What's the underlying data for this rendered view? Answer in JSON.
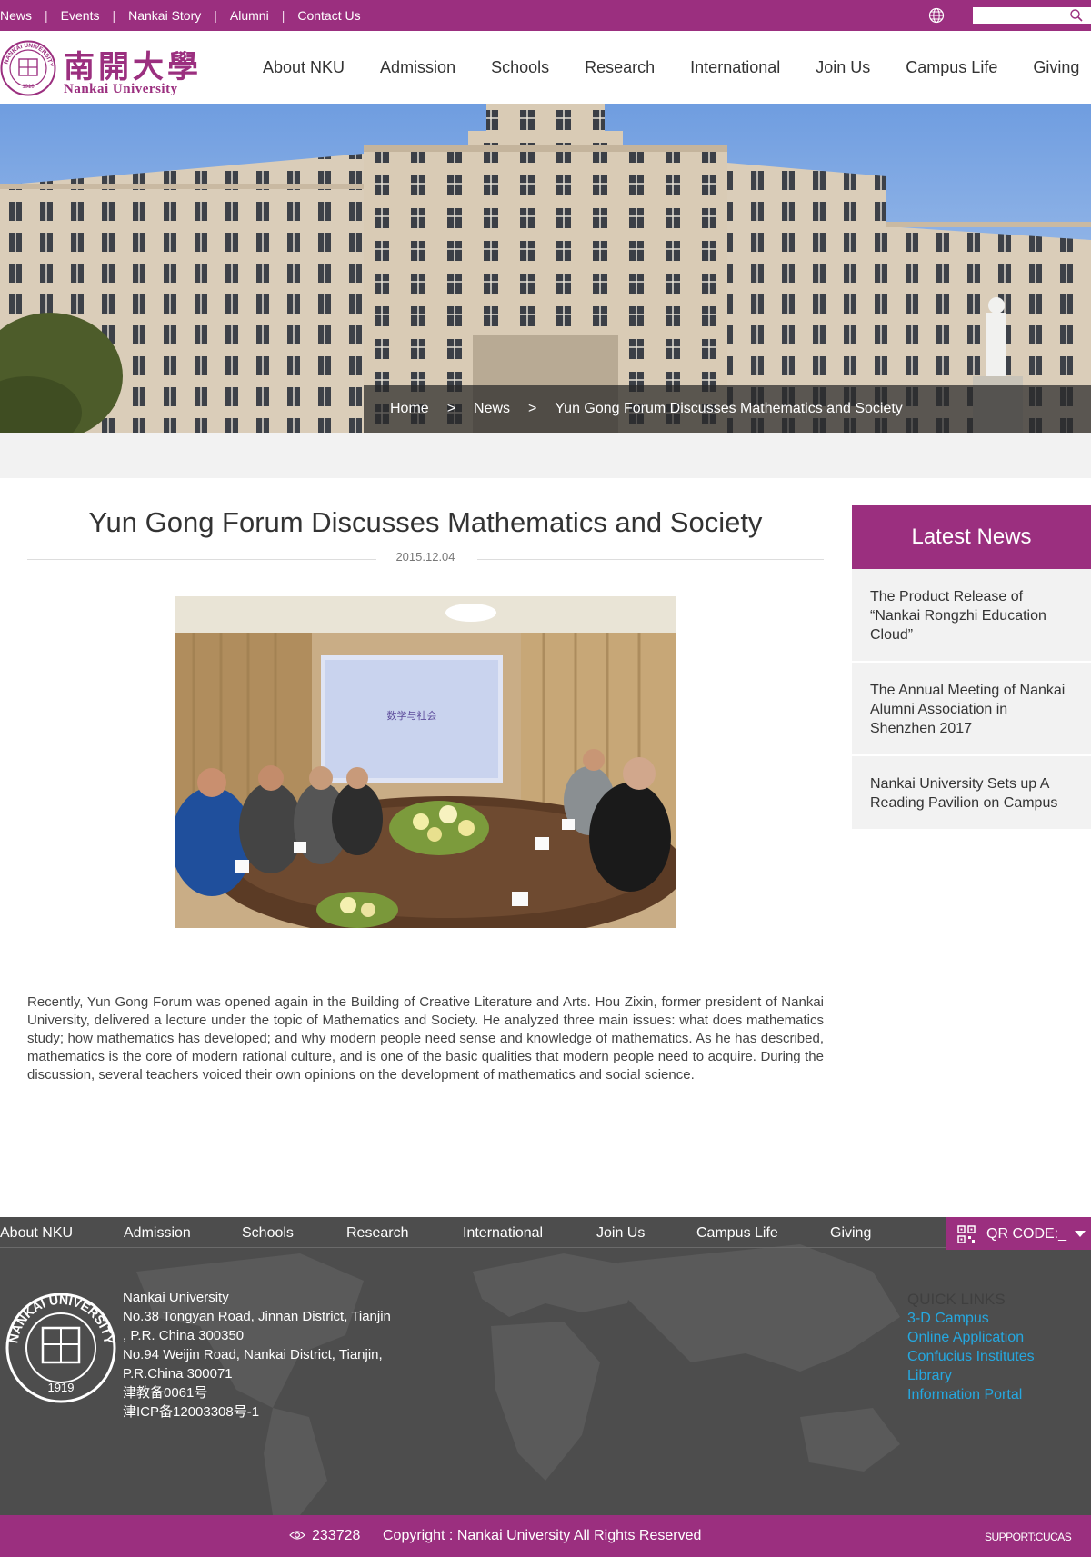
{
  "topbar": {
    "links": [
      "News",
      "Events",
      "Nankai Story",
      "Alumni",
      "Contact Us"
    ],
    "separator": "|",
    "search_placeholder": ""
  },
  "header": {
    "logo_cn": "南開大學",
    "logo_en": "Nankai University",
    "logo_seal_text": "NANKAI UNIVERSITY",
    "logo_seal_year": "1919",
    "nav": [
      "About NKU",
      "Admission",
      "Schools",
      "Research",
      "International",
      "Join Us",
      "Campus Life",
      "Giving"
    ]
  },
  "breadcrumb": {
    "home": "Home",
    "section": "News",
    "current": "Yun Gong Forum Discusses Mathematics and Society",
    "separator": ">"
  },
  "article": {
    "title": "Yun Gong Forum Discusses Mathematics and Society",
    "date": "2015.12.04",
    "photo_screen_title": "数学与社会",
    "body": "Recently, Yun Gong Forum was opened again in the Building of Creative Literature and Arts. Hou Zixin, former president of Nankai University, delivered a lecture under the topic of Mathematics and Society. He analyzed three main issues: what does mathematics study; how mathematics has developed; and why modern people need sense and knowledge of mathematics. As he has described, mathematics is the core of modern rational culture, and is one of the basic qualities that modern people need to acquire. During the discussion, several teachers voiced their own opinions on the development of mathematics and social science."
  },
  "sidebar": {
    "heading": "Latest News",
    "items": [
      "The Product Release of “Nankai Rongzhi Education Cloud”",
      "The Annual Meeting of Nankai Alumni Association in Shenzhen 2017",
      "Nankai University Sets up A Reading Pavilion on Campus"
    ]
  },
  "footer": {
    "nav": [
      "About NKU",
      "Admission",
      "Schools",
      "Research",
      "International",
      "Join Us",
      "Campus Life",
      "Giving"
    ],
    "qr_label": "QR CODE:_",
    "address_lines": [
      "Nankai University",
      "No.38 Tongyan Road, Jinnan District, Tianjin",
      ", P.R. China 300350",
      "No.94 Weijin Road,  Nankai District, Tianjin,",
      "P.R.China  300071",
      "津教备0061号",
      "津ICP备12003308号-1"
    ],
    "quick_links_title": "QUICK LINKS",
    "quick_links": [
      "3-D Campus",
      "Online Application",
      "Confucius Institutes",
      "Library",
      "Information Portal"
    ]
  },
  "bottombar": {
    "visit_count": "233728",
    "copyright": "Copyright : Nankai University All Rights Reserved",
    "support": "SUPPORT:CUCAS"
  },
  "colors": {
    "brand": "#9b2f7f",
    "footer_bg": "#4d4d4d",
    "quick_link": "#25a8e0",
    "sidebar_bg": "#f2f2f2"
  }
}
